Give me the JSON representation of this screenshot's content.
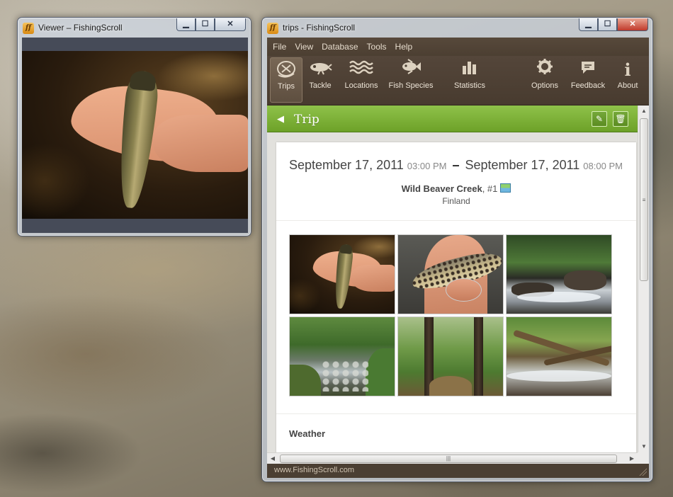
{
  "viewer": {
    "title": "Viewer – FishingScroll",
    "controls": {
      "minimize": "▁",
      "maximize": "☐",
      "close": "✕"
    }
  },
  "main": {
    "title": "trips - FishingScroll",
    "controls": {
      "minimize": "▁",
      "maximize": "☐",
      "close": "✕"
    },
    "menu": [
      "File",
      "View",
      "Database",
      "Tools",
      "Help"
    ],
    "toolbar": {
      "trips": "Trips",
      "tackle": "Tackle",
      "locations": "Locations",
      "fish_species": "Fish Species",
      "statistics": "Statistics",
      "options": "Options",
      "feedback": "Feedback",
      "about": "About"
    },
    "toolbar_icons": {
      "trips": "trips-icon",
      "tackle": "lure-icon",
      "locations": "waves-icon",
      "fish_species": "fish-icon",
      "statistics": "bar-chart-icon",
      "options": "gear-icon",
      "feedback": "speech-bubble-icon",
      "about": "info-icon"
    },
    "trip": {
      "header": "Trip",
      "start_date": "September 17, 2011",
      "start_time": "03:00 PM",
      "end_date": "September 17, 2011",
      "end_time": "08:00 PM",
      "location": "Wild Beaver Creek",
      "location_number": ", #1",
      "country": "Finland",
      "weather_label": "Weather"
    },
    "status": "www.FishingScroll.com",
    "colors": {
      "toolbar_bg": "#4b3f33",
      "header_green": "#7cb236",
      "menu_text": "#e6dccd"
    }
  }
}
